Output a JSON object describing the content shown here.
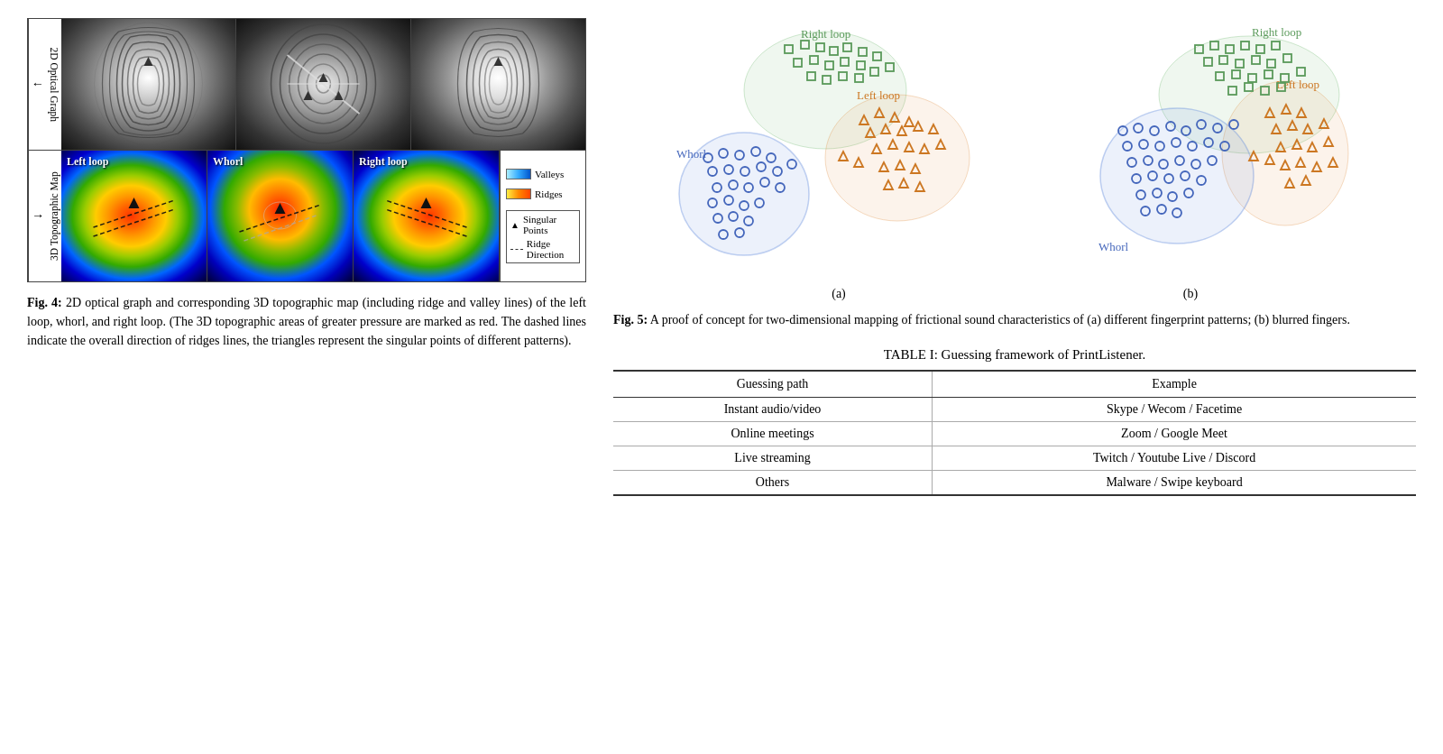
{
  "left": {
    "fig4_top_label": "2D Optical Graph",
    "fig4_bottom_label": "3D Topographic Map",
    "fp_labels": [
      "Left loop",
      "Whorl",
      "Right loop"
    ],
    "legend": {
      "valleys": "Valleys",
      "ridges": "Ridges",
      "singular_points": "Singular Points",
      "ridge_direction": "Ridge Direction"
    },
    "caption_label": "Fig. 4:",
    "caption_text": "2D optical graph and corresponding 3D topographic map (including ridge and valley lines) of the left loop, whorl, and right loop. (The 3D topographic areas of greater pressure are marked as red. The dashed lines indicate the overall direction of ridges lines, the triangles represent the singular points of different patterns)."
  },
  "right": {
    "fig5_caption_label": "Fig. 5:",
    "fig5_caption_text": "A proof of concept for two-dimensional mapping of frictional sound characteristics of (a) different fingerprint patterns; (b) blurred fingers.",
    "scatter_a_label": "(a)",
    "scatter_b_label": "(b)",
    "scatter_clusters": {
      "a": {
        "right_loop_label": "Right loop",
        "left_loop_label": "Left loop",
        "whorl_label": "Whorl"
      },
      "b": {
        "right_loop_label": "Right loop",
        "left_loop_label": "Left loop",
        "whorl_label": "Whorl"
      }
    },
    "table_title": "TABLE I: Guessing framework of PrintListener.",
    "table_headers": [
      "Guessing path",
      "Example"
    ],
    "table_rows": [
      [
        "Instant audio/video",
        "Skype / Wecom / Facetime"
      ],
      [
        "Online meetings",
        "Zoom / Google Meet"
      ],
      [
        "Live streaming",
        "Twitch / Youtube Live / Discord"
      ],
      [
        "Others",
        "Malware / Swipe keyboard"
      ]
    ]
  }
}
